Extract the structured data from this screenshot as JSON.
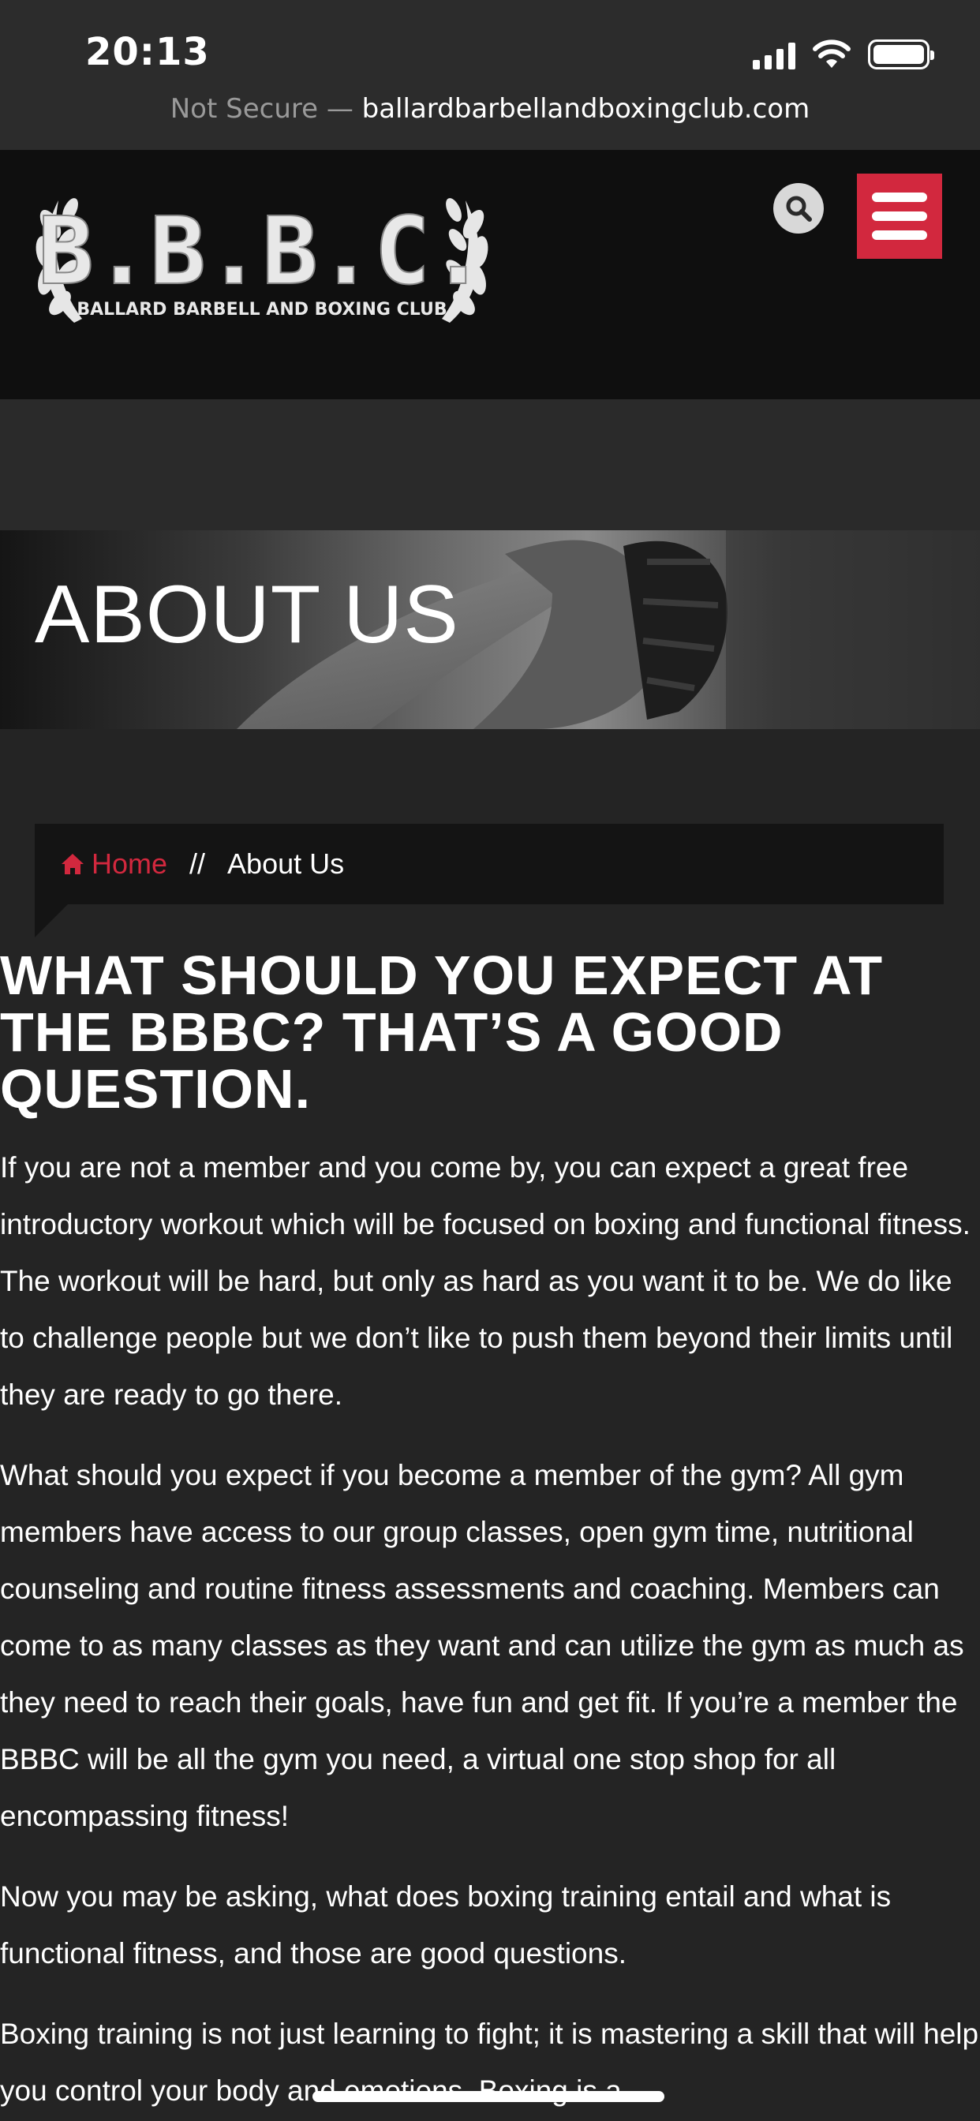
{
  "status_bar": {
    "time": "20:13"
  },
  "browser": {
    "security_label": "Not Secure — ",
    "domain": "ballardbarbellandboxingclub.com"
  },
  "header": {
    "logo_text": "B.B.B.C.",
    "logo_subtext": "BALLARD BARBELL AND BOXING CLUB",
    "search_icon": "search-icon",
    "menu_icon": "hamburger-menu-icon",
    "accent_color": "#d2283e"
  },
  "hero": {
    "title": "ABOUT US"
  },
  "breadcrumb": {
    "home_icon": "home-icon",
    "home_label": "Home",
    "separator": "//",
    "current": "About Us"
  },
  "content": {
    "heading": "WHAT SHOULD YOU EXPECT AT THE BBBC?  THAT’S A GOOD QUESTION.",
    "paragraphs": [
      "If you are not a member and you come by, you can expect a great free introductory workout which will be focused on boxing and functional fitness. The workout will be hard, but only as hard as you want it to be. We do like to challenge people but we don’t like to push them beyond their limits until they are ready to go there.",
      "What should you expect if you become a member of the gym? All gym members have access to our group classes, open gym time, nutritional counseling and routine fitness assessments and coaching. Members can come to as many classes as they want and can utilize the gym as much as they need to reach their goals, have fun and get fit. If you’re a member the BBBC will be all the gym you need, a virtual one stop shop for all encompassing fitness!",
      "Now you may be asking, what does boxing training entail and what is functional fitness, and those are good questions.",
      "Boxing training is not just learning to fight; it is mastering a skill that will help you control your body and emotions. Boxing is a"
    ]
  }
}
